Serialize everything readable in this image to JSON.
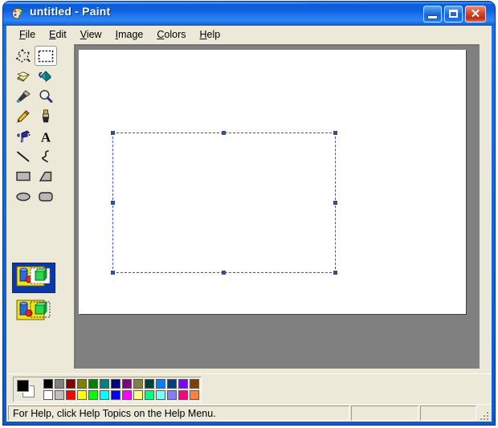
{
  "window": {
    "title": "untitled - Paint",
    "icon": "paint-palette-icon",
    "controls": {
      "minimize": "Minimize",
      "maximize": "Maximize",
      "close": "Close"
    }
  },
  "menu": {
    "items": [
      {
        "label": "File",
        "accel": "F"
      },
      {
        "label": "Edit",
        "accel": "E"
      },
      {
        "label": "View",
        "accel": "V"
      },
      {
        "label": "Image",
        "accel": "I"
      },
      {
        "label": "Colors",
        "accel": "C"
      },
      {
        "label": "Help",
        "accel": "H"
      }
    ]
  },
  "toolbox": {
    "tools": [
      {
        "name": "free-form-select-tool",
        "icon": "free-form-select-icon",
        "selected": false
      },
      {
        "name": "rectangular-select-tool",
        "icon": "rectangular-select-icon",
        "selected": true
      },
      {
        "name": "eraser-tool",
        "icon": "eraser-icon",
        "selected": false
      },
      {
        "name": "fill-with-color-tool",
        "icon": "paint-bucket-icon",
        "selected": false
      },
      {
        "name": "pick-color-tool",
        "icon": "eyedropper-icon",
        "selected": false
      },
      {
        "name": "magnifier-tool",
        "icon": "magnifier-icon",
        "selected": false
      },
      {
        "name": "pencil-tool",
        "icon": "pencil-icon",
        "selected": false
      },
      {
        "name": "brush-tool",
        "icon": "paintbrush-icon",
        "selected": false
      },
      {
        "name": "airbrush-tool",
        "icon": "airbrush-icon",
        "selected": false
      },
      {
        "name": "text-tool",
        "icon": "text-a-icon",
        "selected": false
      },
      {
        "name": "line-tool",
        "icon": "line-icon",
        "selected": false
      },
      {
        "name": "curve-tool",
        "icon": "curve-icon",
        "selected": false
      },
      {
        "name": "rectangle-tool",
        "icon": "rectangle-icon",
        "selected": false
      },
      {
        "name": "polygon-tool",
        "icon": "polygon-icon",
        "selected": false
      },
      {
        "name": "ellipse-tool",
        "icon": "ellipse-icon",
        "selected": false
      },
      {
        "name": "rounded-rectangle-tool",
        "icon": "rounded-rectangle-icon",
        "selected": false
      }
    ],
    "options": [
      {
        "name": "opaque-selection-option",
        "icon": "opaque-background-icon",
        "selected": true
      },
      {
        "name": "transparent-selection-option",
        "icon": "transparent-background-icon",
        "selected": false
      }
    ]
  },
  "canvas": {
    "background": "#ffffff",
    "workspace_background": "#808080",
    "selection": {
      "visible": true,
      "style": "dashed",
      "color": "#3a5fb0",
      "handle_color": "#2d4f9e",
      "handles": [
        "tl",
        "tm",
        "tr",
        "ml",
        "mr",
        "bl",
        "bm",
        "br"
      ]
    }
  },
  "palette": {
    "foreground": "#000000",
    "background": "#ffffff",
    "top_row": [
      "#000000",
      "#808080",
      "#800000",
      "#808000",
      "#008000",
      "#008080",
      "#000080",
      "#800080",
      "#808040",
      "#004040",
      "#0080ff",
      "#004080",
      "#8000ff",
      "#804000"
    ],
    "bottom_row": [
      "#ffffff",
      "#c0c0c0",
      "#ff0000",
      "#ffff00",
      "#00ff00",
      "#00ffff",
      "#0000ff",
      "#ff00ff",
      "#ffff80",
      "#00ff80",
      "#80ffff",
      "#8080ff",
      "#ff0080",
      "#ff8040"
    ]
  },
  "status_bar": {
    "message": "For Help, click Help Topics on the Help Menu.",
    "position": "",
    "size": ""
  }
}
